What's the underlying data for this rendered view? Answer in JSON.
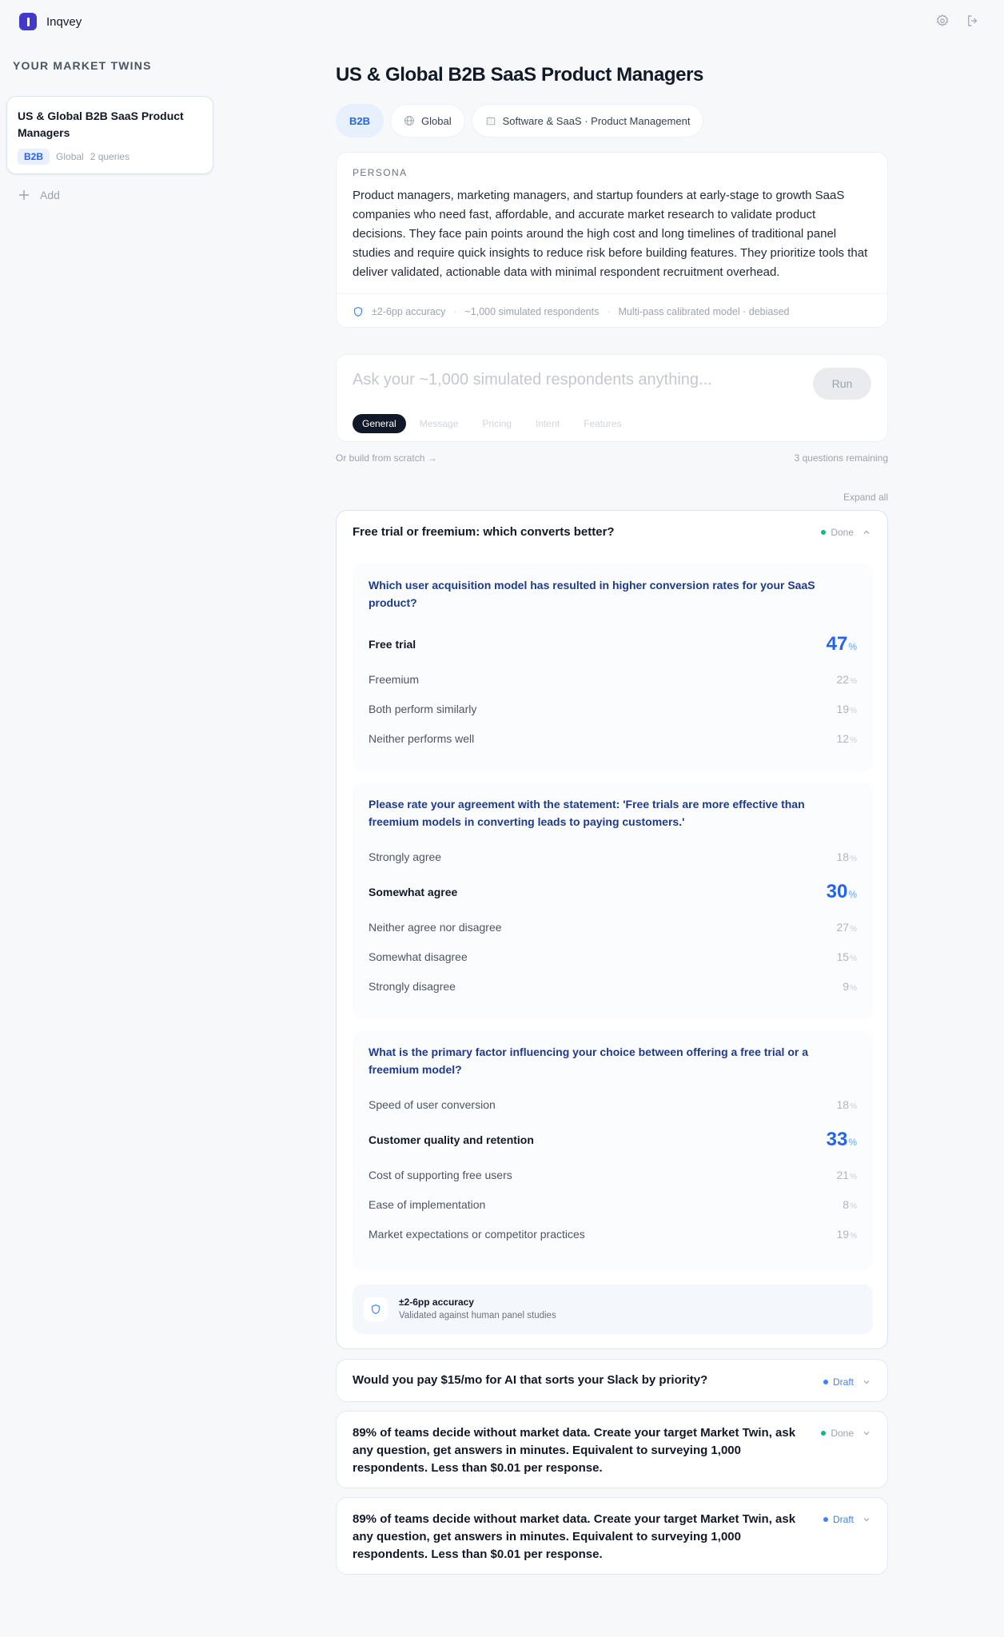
{
  "app": {
    "name": "Inqvey"
  },
  "header": {
    "icons": [
      "gear-icon",
      "logout-icon"
    ]
  },
  "sidebar": {
    "title": "YOUR MARKET TWINS",
    "twins": [
      {
        "name": "US & Global B2B SaaS Product Managers",
        "badge": "B2B",
        "region": "Global",
        "queries": "2 queries"
      }
    ],
    "add_label": "Add"
  },
  "main": {
    "title": "US & Global B2B SaaS Product Managers",
    "chips": [
      "B2B",
      "Global",
      "Software & SaaS · Product Management"
    ],
    "persona": {
      "label": "PERSONA",
      "text": "Product managers, marketing managers, and startup founders at early-stage to growth SaaS companies who need fast, affordable, and accurate market research to validate product decisions. They face pain points around the high cost and long timelines of traditional panel studies and require quick insights to reduce risk before building features. They prioritize tools that deliver validated, actionable data with minimal respondent recruitment overhead.",
      "footer": [
        "±2-6pp accuracy",
        "~1,000 simulated respondents",
        "Multi-pass calibrated model · debiased"
      ]
    },
    "ask": {
      "placeholder": "Ask your ~1,000 simulated respondents anything...",
      "run_label": "Run",
      "tabs": [
        "General",
        "Message",
        "Pricing",
        "Intent",
        "Features"
      ],
      "active_tab": "General"
    },
    "build_scratch": "Or build from scratch →",
    "remaining": "3 questions remaining",
    "expand_all": "Expand all",
    "studies": [
      {
        "title": "Free trial or freemium: which converts better?",
        "status": "Done",
        "status_color": "#10b981",
        "questions": [
          {
            "text": "Which user acquisition model has resulted in higher conversion rates for your SaaS product?",
            "options": [
              {
                "label": "Free trial",
                "value": "47",
                "top": true
              },
              {
                "label": "Freemium",
                "value": "22"
              },
              {
                "label": "Both perform similarly",
                "value": "19"
              },
              {
                "label": "Neither performs well",
                "value": "12"
              }
            ]
          },
          {
            "text": "Please rate your agreement with the statement: 'Free trials are more effective than freemium models in converting leads to paying customers.'",
            "options": [
              {
                "label": "Strongly agree",
                "value": "18"
              },
              {
                "label": "Somewhat agree",
                "value": "30",
                "top": true
              },
              {
                "label": "Neither agree nor disagree",
                "value": "27"
              },
              {
                "label": "Somewhat disagree",
                "value": "15"
              },
              {
                "label": "Strongly disagree",
                "value": "9"
              }
            ]
          },
          {
            "text": "What is the primary factor influencing your choice between offering a free trial or a freemium model?",
            "options": [
              {
                "label": "Speed of user conversion",
                "value": "18"
              },
              {
                "label": "Customer quality and retention",
                "value": "33",
                "top": true
              },
              {
                "label": "Cost of supporting free users",
                "value": "21"
              },
              {
                "label": "Ease of implementation",
                "value": "8"
              },
              {
                "label": "Market expectations or competitor practices",
                "value": "19"
              }
            ]
          }
        ],
        "accuracy": {
          "title": "±2-6pp accuracy",
          "subtitle": "Validated against human panel studies"
        }
      },
      {
        "title": "Would you pay $15/mo for AI that sorts your Slack by priority?",
        "status": "Draft",
        "status_color": "#3b82f6"
      },
      {
        "title": "89% of teams decide without market data. Create your target Market Twin, ask any question, get answers in minutes. Equivalent to surveying 1,000 respondents. Less than $0.01 per response.",
        "status": "Done",
        "status_color": "#10b981"
      },
      {
        "title": "89% of teams decide without market data. Create your target Market Twin, ask any question, get answers in minutes. Equivalent to surveying 1,000 respondents. Less than $0.01 per response.",
        "status": "Draft",
        "status_color": "#3b82f6"
      }
    ],
    "percent_sign": "%"
  }
}
